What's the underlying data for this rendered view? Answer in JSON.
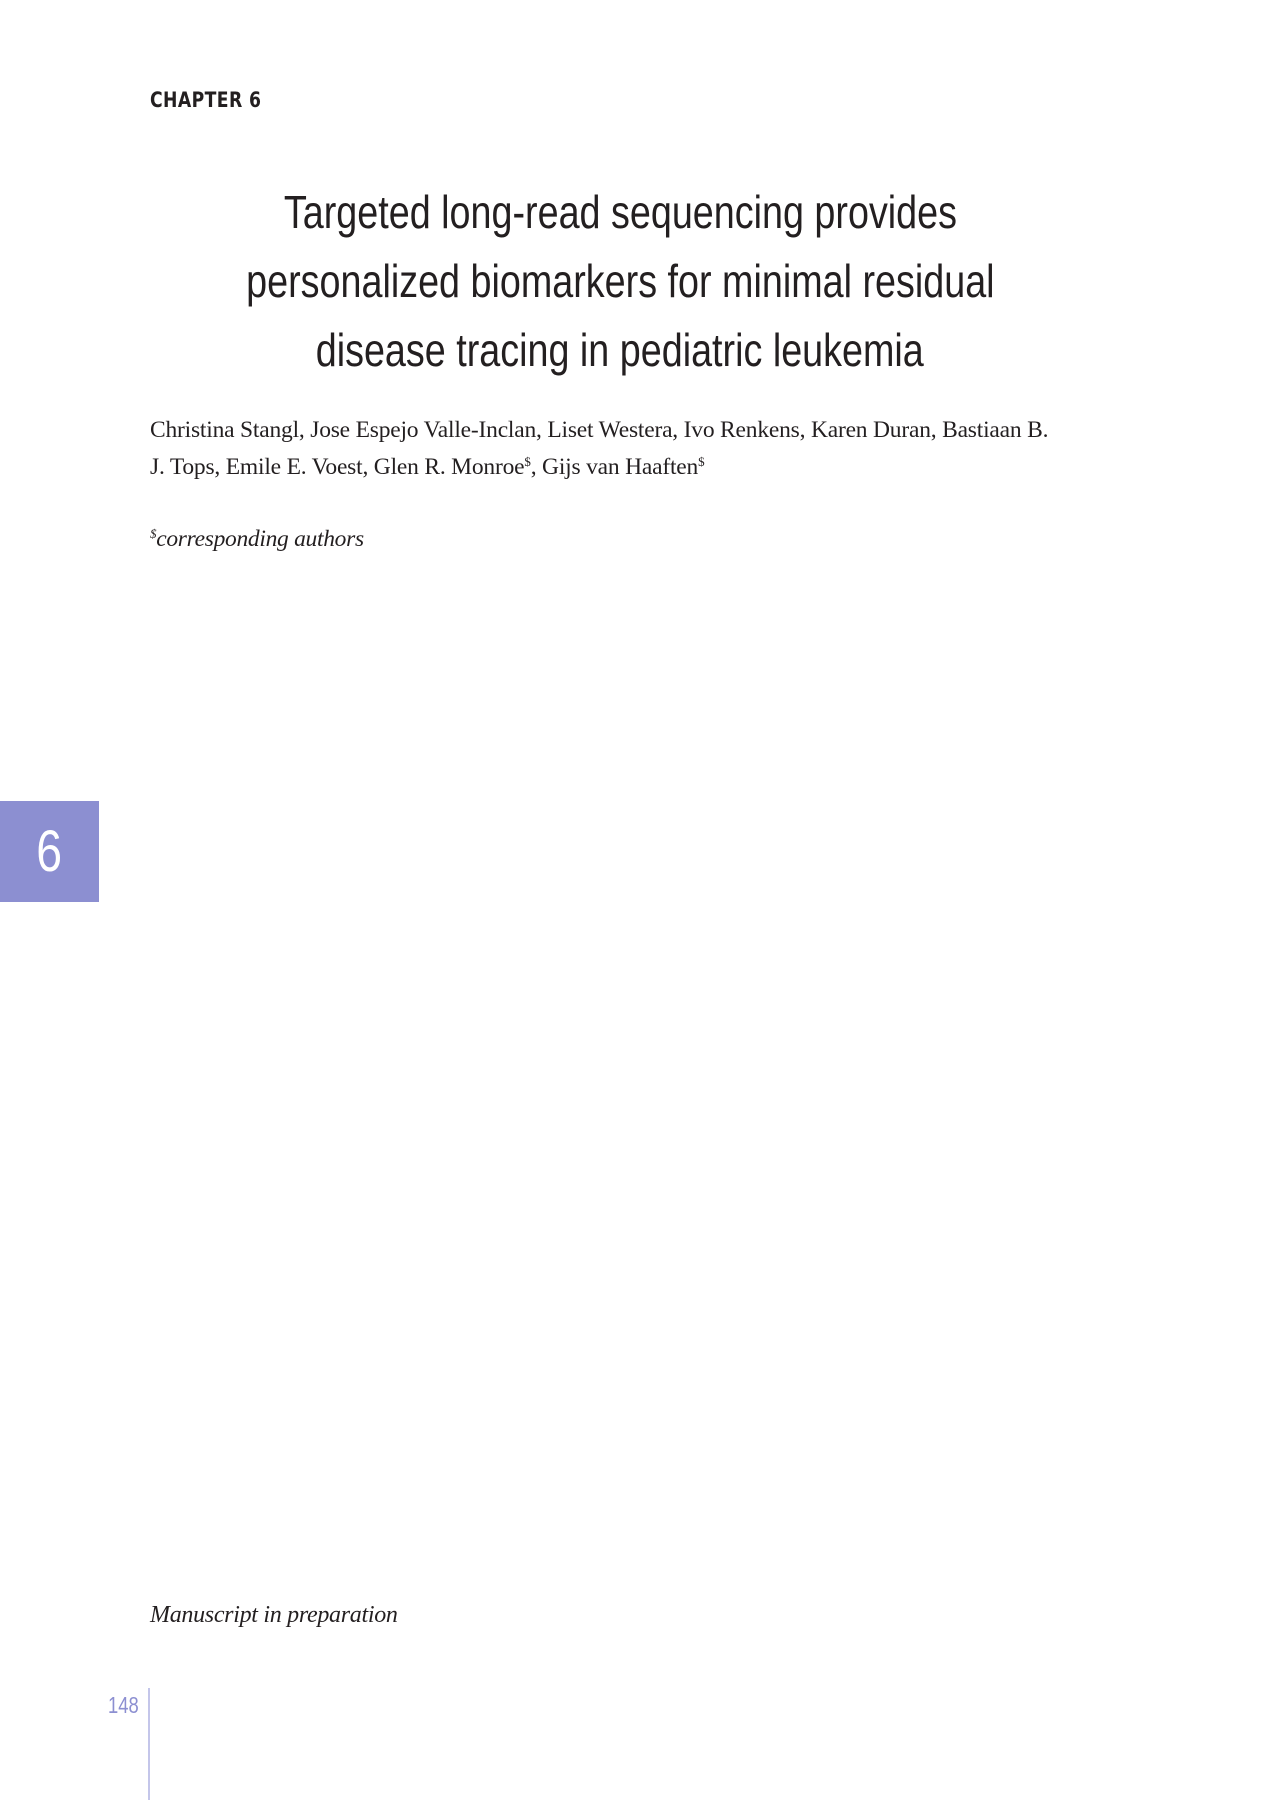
{
  "header": {
    "chapter_label": "CHAPTER 6"
  },
  "article": {
    "title_lines": [
      "Targeted long-read sequencing provides",
      "personalized biomarkers for minimal residual",
      "disease tracing in pediatric leukemia"
    ],
    "authors_line1": "Christina Stangl, Jose Espejo Valle-Inclan, Liset Westera, Ivo Renkens, Karen Duran, Bastiaan B.",
    "authors_line2_a": "J. Tops, Emile E. Voest, Glen R. Monroe",
    "authors_line2_b": ", Gijs van Haaften",
    "author_mark": "$",
    "corresponding_note": "corresponding authors",
    "status_note": "Manuscript in preparation"
  },
  "side_tab": {
    "chapter_number": "6",
    "color": "#8c8fd1"
  },
  "footer": {
    "page_number": "148",
    "accent_color": "#8c8fd1"
  }
}
